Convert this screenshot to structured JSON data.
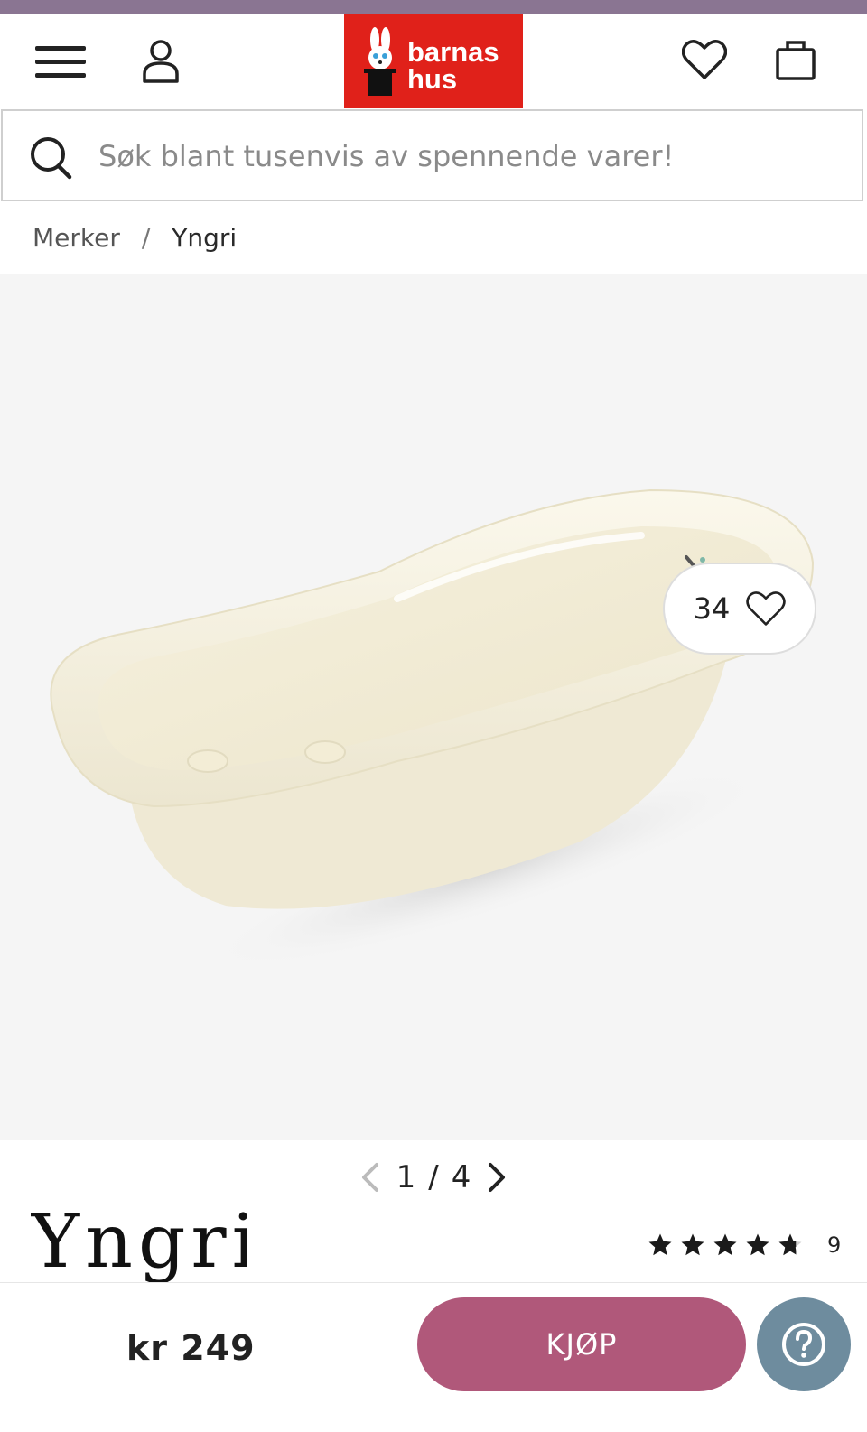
{
  "header": {
    "logo_line1": "barnas",
    "logo_line2": "hus",
    "menu_icon": "menu-icon",
    "account_icon": "user-icon",
    "wishlist_icon": "heart-icon",
    "cart_icon": "shopping-bag-icon"
  },
  "search": {
    "placeholder": "Søk blant tusenvis av spennende varer!",
    "icon": "search-icon"
  },
  "breadcrumb": {
    "items": [
      "Merker",
      "Yngri"
    ],
    "separator": "/"
  },
  "gallery": {
    "favorites_count": "34",
    "current": "1",
    "separator": "/",
    "total": "4"
  },
  "product": {
    "brand_logo_text": "Yngri",
    "rating_stars": 4.7,
    "rating_max": 5,
    "review_count": "9"
  },
  "purchase": {
    "price": "kr 249",
    "buy_label": "KJØP",
    "help_icon": "question-icon"
  },
  "colors": {
    "top_strip": "#8a7592",
    "logo_bg": "#e0211a",
    "buy_button": "#b0587a",
    "help_button": "#6e8c9e",
    "gallery_bg": "#f5f5f5"
  }
}
